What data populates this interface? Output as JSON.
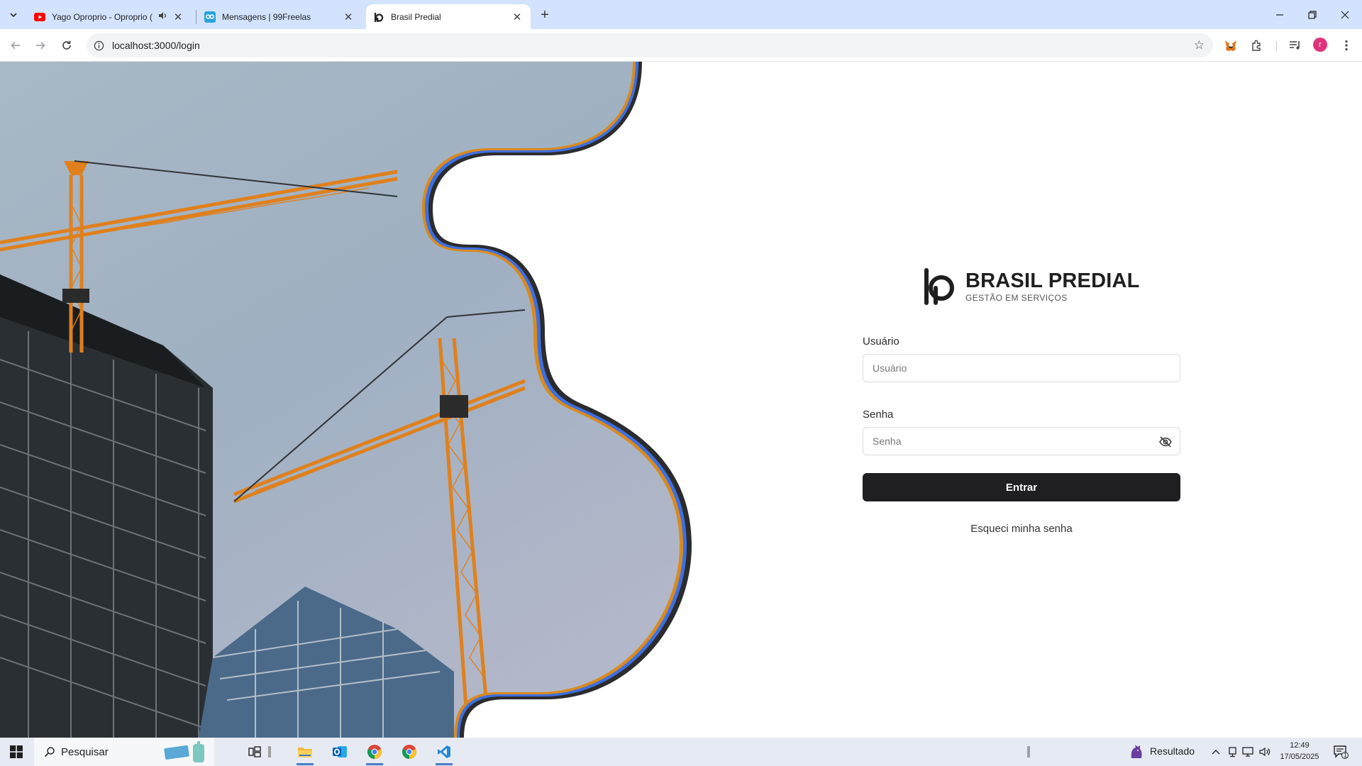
{
  "browser": {
    "tabs": [
      {
        "title": "Yago Oproprio - Oproprio (",
        "favicon": "youtube-icon",
        "audio": true,
        "active": false
      },
      {
        "title": "Mensagens | 99Freelas",
        "favicon": "99freelas-icon",
        "audio": false,
        "active": false
      },
      {
        "title": "Brasil Predial",
        "favicon": "brasil-predial-icon",
        "audio": false,
        "active": true
      }
    ],
    "url": "localhost:3000/login",
    "profile_initial": "r"
  },
  "login": {
    "brand_name": "BRASIL PREDIAL",
    "brand_tagline": "GESTÃO EM SERVIÇOS",
    "username_label": "Usuário",
    "username_placeholder": "Usuário",
    "password_label": "Senha",
    "password_placeholder": "Senha",
    "submit_label": "Entrar",
    "forgot_label": "Esqueci minha senha"
  },
  "taskbar": {
    "search_placeholder": "Pesquisar",
    "weather_label": "Resultado",
    "time": "12:49",
    "date": "17/05/2025",
    "notification_count": "1"
  },
  "colors": {
    "accent_orange": "#d98a1e",
    "accent_blue": "#3d6fe0",
    "accent_dark": "#2b2b2d",
    "button_bg": "#1f1f21"
  }
}
